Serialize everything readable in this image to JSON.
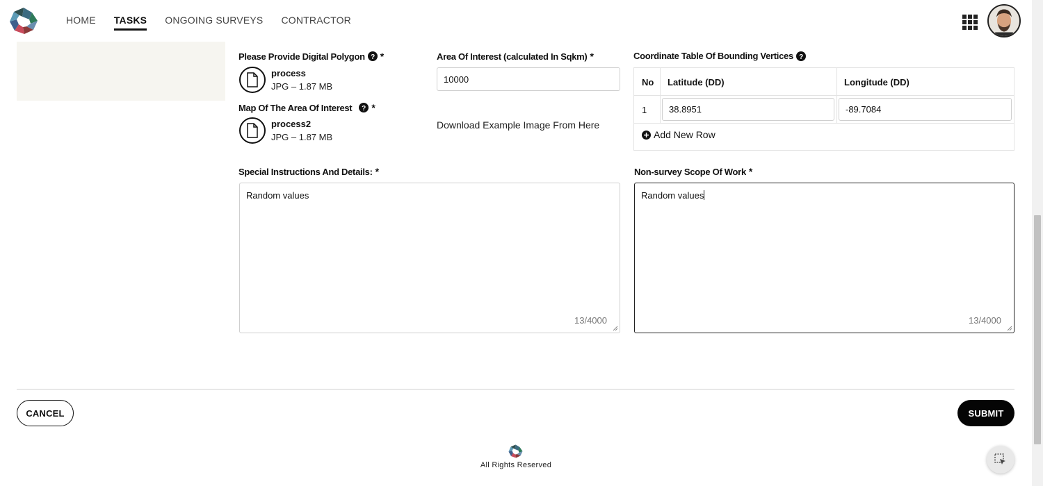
{
  "nav": {
    "items": [
      {
        "label": "HOME",
        "active": false
      },
      {
        "label": "TASKS",
        "active": true
      },
      {
        "label": "ONGOING SURVEYS",
        "active": false
      },
      {
        "label": "CONTRACTOR",
        "active": false
      }
    ]
  },
  "form": {
    "polygon_label": "Please Provide Digital Polygon",
    "polygon_file": {
      "name": "process",
      "meta": "JPG – 1.87 MB"
    },
    "map_label": "Map Of The Area Of Interest",
    "map_file": {
      "name": "process2",
      "meta": "JPG – 1.87 MB"
    },
    "area_label": "Area Of Interest (calculated In Sqkm)",
    "area_value": "10000",
    "download_link": "Download Example Image From Here",
    "coord_label": "Coordinate Table Of Bounding Vertices",
    "coord_table": {
      "headers": [
        "No",
        "Latitude (DD)",
        "Longitude (DD)"
      ],
      "rows": [
        {
          "no": "1",
          "lat": "38.8951",
          "lon": "-89.7084"
        }
      ],
      "add_row_label": "Add New Row"
    },
    "special_label": "Special Instructions And Details:",
    "special_value": "Random values",
    "special_count": "13/4000",
    "scope_label": "Non-survey Scope Of Work",
    "scope_value": "Random values",
    "scope_count": "13/4000",
    "required_mark": "*"
  },
  "actions": {
    "cancel": "CANCEL",
    "submit": "SUBMIT"
  },
  "footer": {
    "text": "All Rights Reserved"
  },
  "icons": {
    "apps": "grid-icon",
    "help": "question-circle-icon",
    "file": "file-icon",
    "add": "plus-circle-icon",
    "float": "cursor-select-icon"
  },
  "colors": {
    "accent": "#050505",
    "panel": "#f6f5f0",
    "border": "#cfcfcf"
  }
}
